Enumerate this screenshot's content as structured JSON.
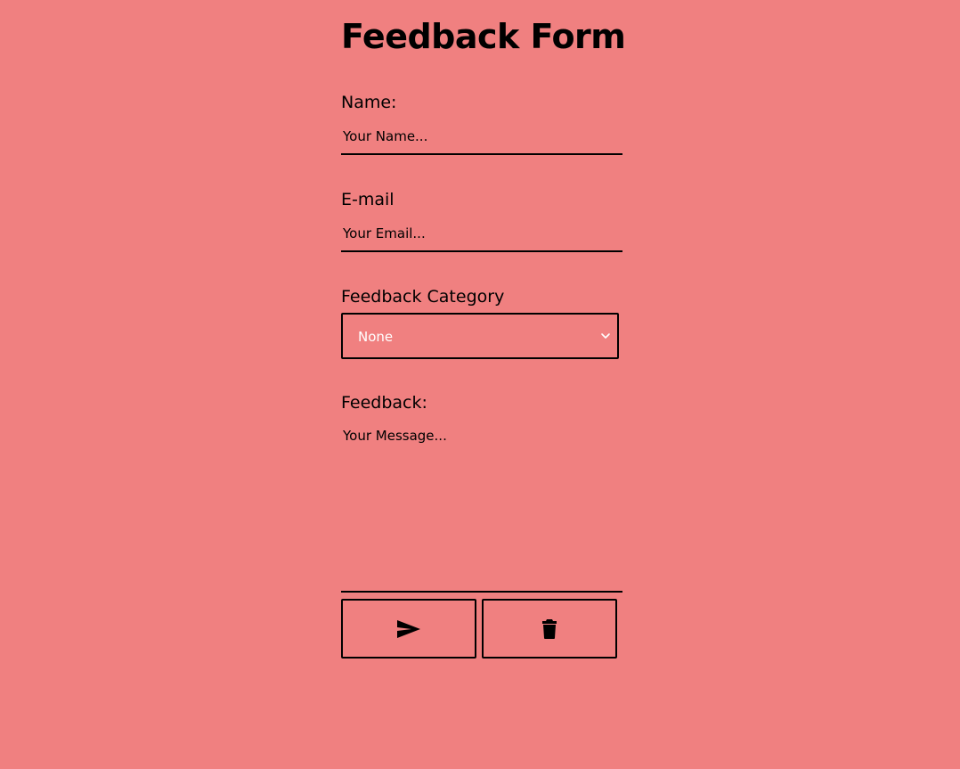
{
  "title": "Feedback Form",
  "fields": {
    "name": {
      "label": "Name:",
      "placeholder": "Your Name..."
    },
    "email": {
      "label": "E-mail",
      "placeholder": "Your Email..."
    },
    "category": {
      "label": "Feedback Category",
      "selected": "None"
    },
    "feedback": {
      "label": "Feedback:",
      "placeholder": "Your Message..."
    }
  },
  "buttons": {
    "submit_icon": "send-icon",
    "clear_icon": "trash-icon"
  },
  "colors": {
    "background": "#f08080",
    "border": "#000000",
    "select_text": "#ffffff"
  }
}
